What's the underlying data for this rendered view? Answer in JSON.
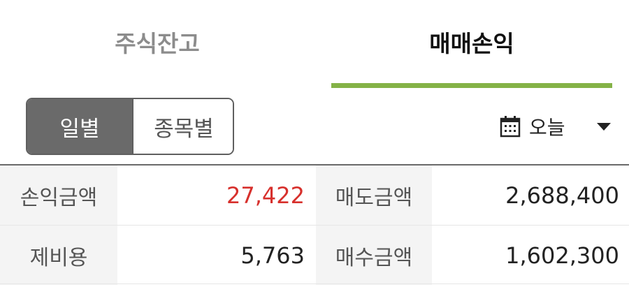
{
  "tabs": [
    {
      "label": "주식잔고",
      "active": false
    },
    {
      "label": "매매손익",
      "active": true
    }
  ],
  "accent_color": "#84b247",
  "segment": {
    "options": [
      "일별",
      "종목별"
    ],
    "selected": "일별"
  },
  "date_filter": {
    "icon": "calendar-icon",
    "label": "오늘",
    "dropdown_icon": "caret-down-icon"
  },
  "summary": {
    "rows": [
      {
        "left_label": "손익금액",
        "left_value": "27,422",
        "right_label": "매도금액",
        "right_value": "2,688,400"
      },
      {
        "left_label": "제비용",
        "left_value": "5,763",
        "right_label": "매수금액",
        "right_value": "1,602,300"
      }
    ],
    "profit_color": "#d7302c"
  }
}
